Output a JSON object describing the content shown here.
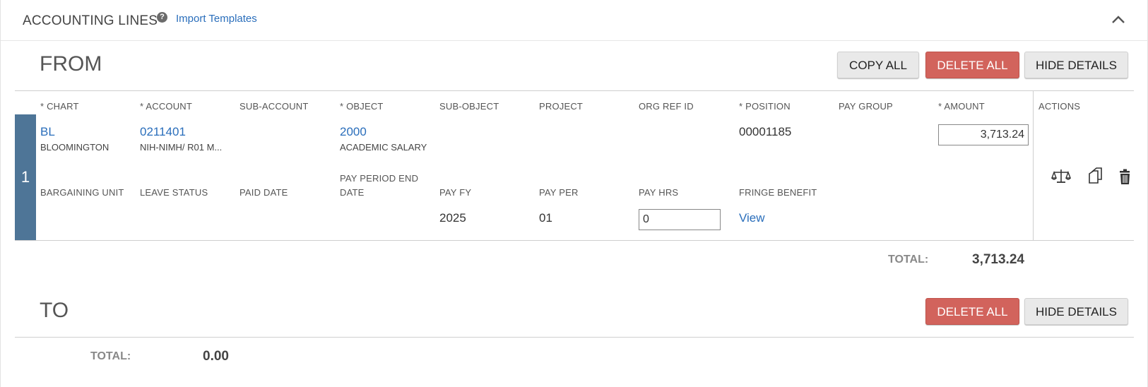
{
  "header": {
    "title": "ACCOUNTING LINES",
    "help_icon": "?",
    "import_link": "Import Templates"
  },
  "from": {
    "title": "FROM",
    "buttons": {
      "copy_all": "COPY ALL",
      "delete_all": "DELETE ALL",
      "hide_details": "HIDE DETAILS"
    },
    "columns": {
      "chart": "* CHART",
      "account": "* ACCOUNT",
      "sub_account": "SUB-ACCOUNT",
      "object": "* OBJECT",
      "sub_object": "SUB-OBJECT",
      "project": "PROJECT",
      "org_ref_id": "ORG REF ID",
      "position": "* POSITION",
      "pay_group": "PAY GROUP",
      "amount": "* AMOUNT",
      "actions": "ACTIONS"
    },
    "detail_columns": {
      "bargaining_unit": "BARGAINING UNIT",
      "leave_status": "LEAVE STATUS",
      "paid_date": "PAID DATE",
      "pay_period_end_1": "PAY PERIOD END",
      "pay_period_end_2": "DATE",
      "pay_fy": "PAY FY",
      "pay_per": "PAY PER",
      "pay_hrs": "PAY HRS",
      "fringe_benefit": "FRINGE BENEFIT"
    },
    "row": {
      "number": "1",
      "chart": "BL",
      "chart_desc": "BLOOMINGTON",
      "account": "0211401",
      "account_desc": "NIH-NIMH/ R01 M...",
      "object": "2000",
      "object_desc": "ACADEMIC SALARY",
      "position": "00001185",
      "amount": "3,713.24",
      "pay_fy": "2025",
      "pay_per": "01",
      "pay_hrs": "0",
      "fringe_benefit": "View"
    },
    "total_label": "TOTAL:",
    "total_value": "3,713.24"
  },
  "to": {
    "title": "TO",
    "buttons": {
      "delete_all": "DELETE ALL",
      "hide_details": "HIDE DETAILS"
    },
    "total_label": "TOTAL:",
    "total_value": "0.00"
  },
  "icons": {
    "balance": "balance-scale-icon",
    "copy": "copy-icon",
    "delete": "trash-icon",
    "collapse": "chevron-up-icon"
  },
  "colors": {
    "link": "#2a6ebb",
    "danger": "#d2635c",
    "row_marker": "#4e7597"
  }
}
